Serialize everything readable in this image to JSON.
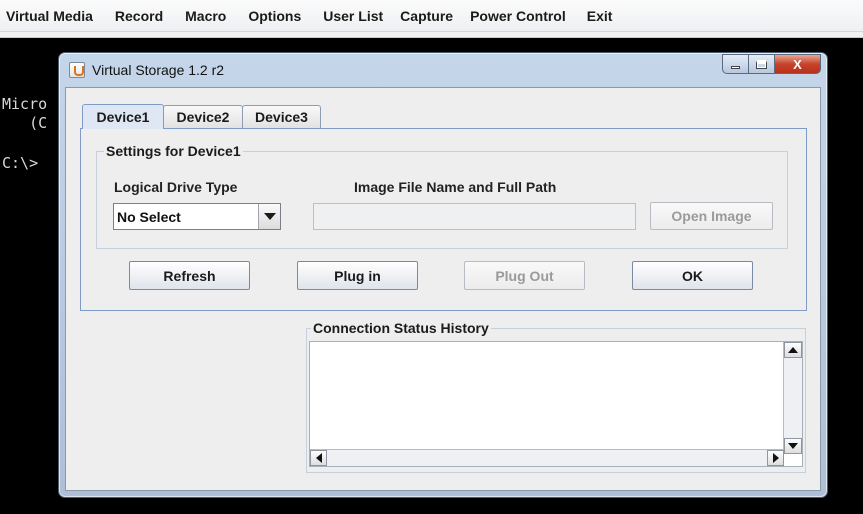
{
  "menu": [
    "Virtual Media",
    "Record",
    "Macro",
    "Options",
    "User List",
    "Capture",
    "Power Control",
    "Exit"
  ],
  "console": {
    "line1": "Micro",
    "line2": "   (C",
    "line3": "C:\\>"
  },
  "window": {
    "title": "Virtual Storage 1.2 r2",
    "close_glyph": "X"
  },
  "tabs": [
    {
      "label": "Device1",
      "active": true
    },
    {
      "label": "Device2",
      "active": false
    },
    {
      "label": "Device3",
      "active": false
    }
  ],
  "settings": {
    "group_title": "Settings for Device1",
    "drive_type_label": "Logical Drive Type",
    "drive_type_value": "No Select",
    "image_path_label": "Image File Name and Full Path",
    "image_path_value": "",
    "open_image_label": "Open Image"
  },
  "buttons": {
    "refresh": "Refresh",
    "plug_in": "Plug in",
    "plug_out": "Plug Out",
    "ok": "OK"
  },
  "history": {
    "title": "Connection Status History",
    "content": ""
  },
  "colors": {
    "accent": "#7f9cc7",
    "close_button": "#c7432b",
    "background": "#000000"
  },
  "icons": [
    "java-app-icon",
    "minimize-icon",
    "maximize-icon",
    "close-icon",
    "dropdown-arrow-icon",
    "scroll-up-icon",
    "scroll-down-icon",
    "scroll-left-icon",
    "scroll-right-icon"
  ]
}
